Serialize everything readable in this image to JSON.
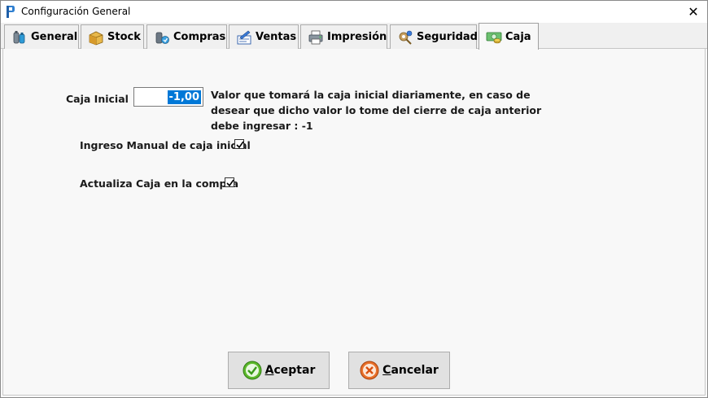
{
  "window": {
    "title": "Configuración General",
    "close_glyph": "✕"
  },
  "tabs": [
    {
      "label": "General",
      "icon": "bottles-icon",
      "active": false
    },
    {
      "label": "Stock",
      "icon": "box-icon",
      "active": false
    },
    {
      "label": "Compras",
      "icon": "purchase-icon",
      "active": false
    },
    {
      "label": "Ventas",
      "icon": "sales-icon",
      "active": false
    },
    {
      "label": "Impresión",
      "icon": "printer-icon",
      "active": false
    },
    {
      "label": "Seguridad",
      "icon": "security-icon",
      "active": false
    },
    {
      "label": "Caja",
      "icon": "cash-icon",
      "active": true
    }
  ],
  "form": {
    "caja_inicial_label": "Caja Inicial",
    "caja_inicial_value": "-1,00",
    "help_text": "Valor que tomará la caja inicial diariamente, en caso de desear que dicho valor lo tome del cierre de caja anterior debe ingresar : -1",
    "ingreso_manual_label": "Ingreso Manual de caja inicial",
    "ingreso_manual_checked": true,
    "actualiza_caja_label": "Actualiza Caja en la compra",
    "actualiza_caja_checked": true
  },
  "buttons": {
    "accept_label": "Aceptar",
    "cancel_label": "Cancelar"
  },
  "colors": {
    "selection": "#0078d7",
    "accept_icon": "#5cb82a",
    "cancel_icon": "#e8702a"
  }
}
